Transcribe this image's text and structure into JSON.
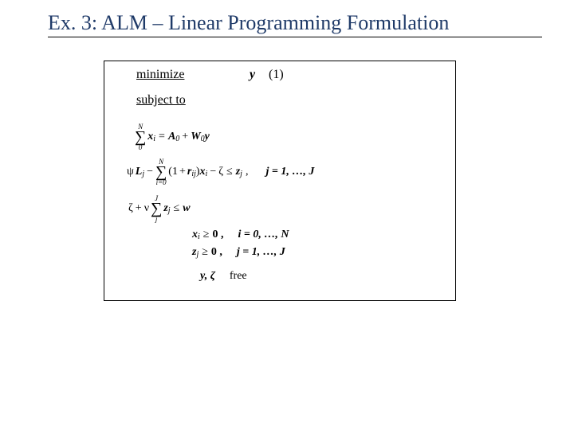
{
  "title": "Ex. 3: ALM – Linear Programming Formulation",
  "minimize": "minimize",
  "objective_var": "y",
  "eq_num": "(1)",
  "subject_to": "subject to",
  "c1": {
    "sum_upper": "N",
    "sum_lower": "0",
    "lhs_x": "x",
    "lhs_sub": "i",
    "eq": "=",
    "A": "A",
    "Asub": "0",
    "plus": "+",
    "W": "W",
    "Wsub": "0",
    "y": "y"
  },
  "c2": {
    "psi": "ψ",
    "L": "L",
    "Lsub": "j",
    "minus": "−",
    "sum_upper": "N",
    "sum_lower": "i=0",
    "lparen": "(",
    "one": "1",
    "plus": "+",
    "r": "r",
    "rsub": "ij",
    "rparen": ")",
    "x": "x",
    "xsub": "i",
    "minus2": "−",
    "zeta": "ζ",
    "le": "≤",
    "z": "z",
    "zsub": "j",
    "comma": ",",
    "range": "j = 1, …, J"
  },
  "c3": {
    "zeta": "ζ",
    "plus": "+",
    "nu": "ν",
    "sum_upper": "J",
    "sum_lower": "j",
    "z": "z",
    "zsub": "j",
    "le": "≤",
    "w": "w"
  },
  "c4": {
    "x": "x",
    "xsub": "i",
    "ge": "≥",
    "zero": "0 ,",
    "range": "i = 0, …, N"
  },
  "c5": {
    "z": "z",
    "zsub": "j",
    "ge": "≥",
    "zero": "0 ,",
    "range": "j = 1, …, J"
  },
  "c6": {
    "vars": "y, ζ",
    "free": "free"
  }
}
